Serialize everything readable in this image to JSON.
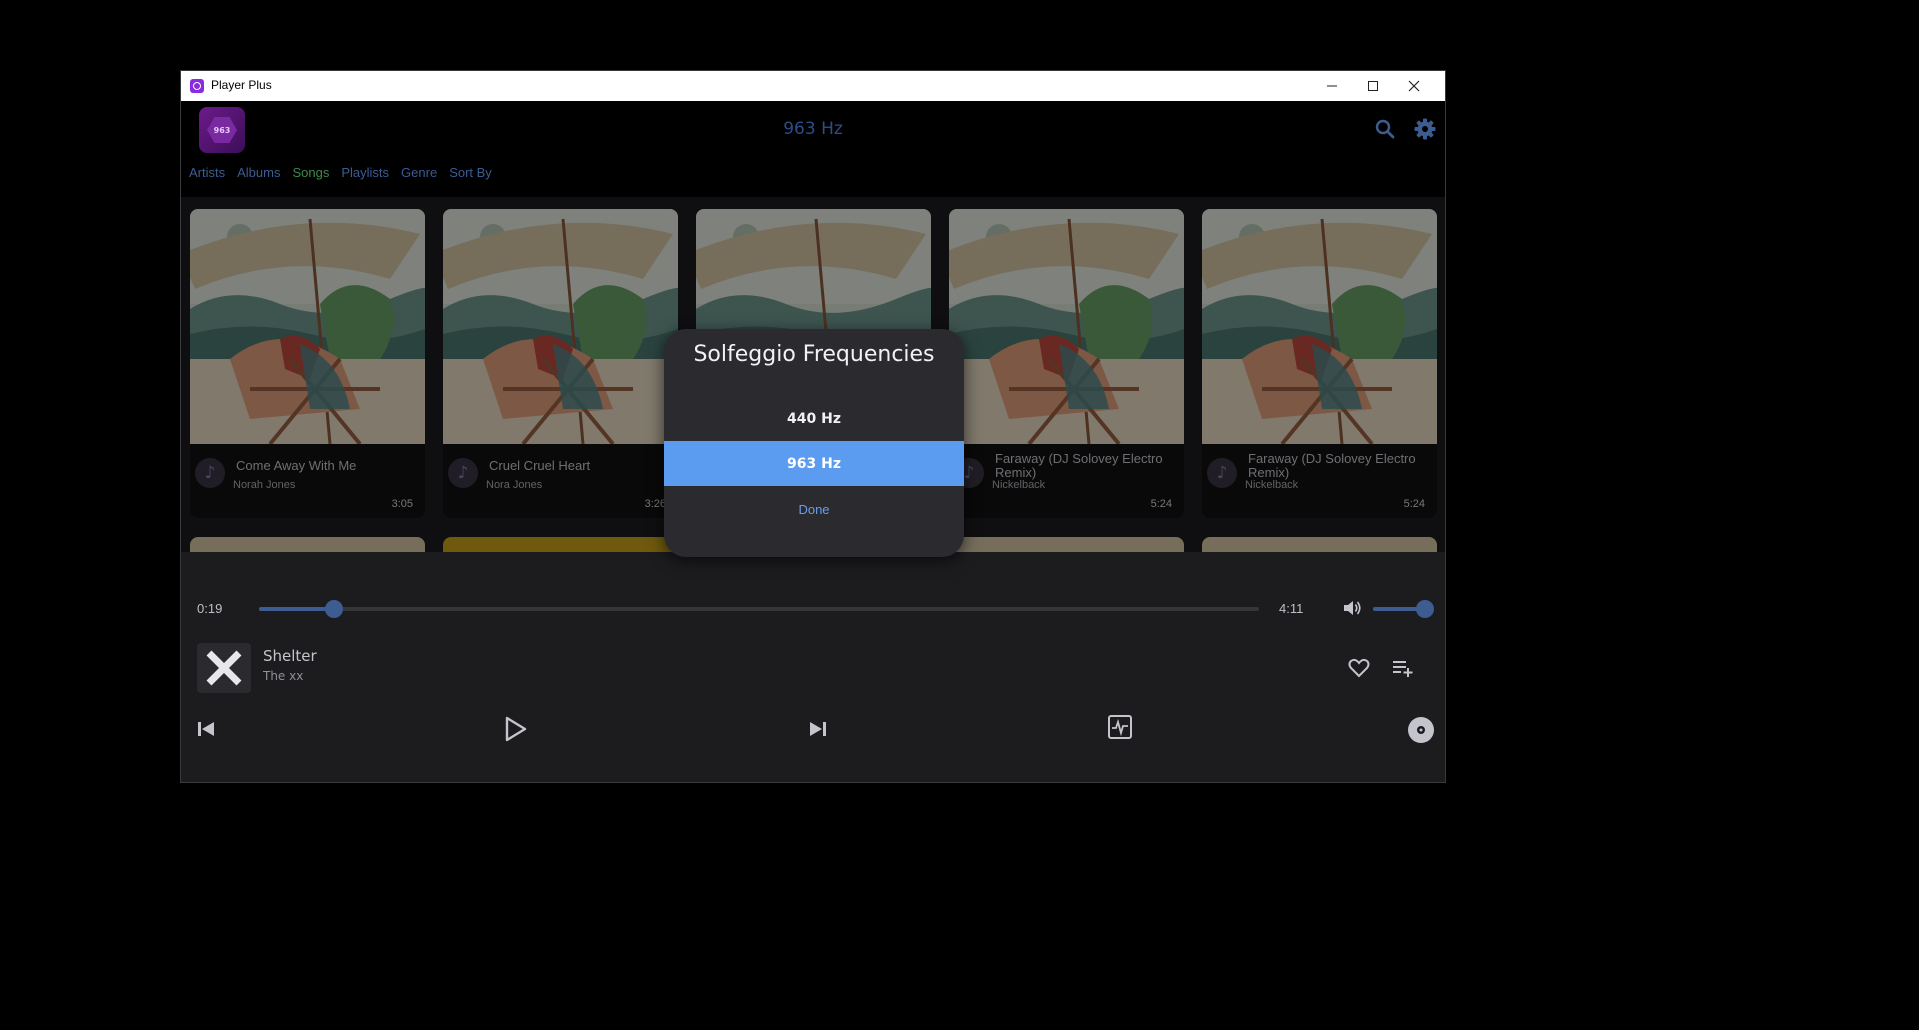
{
  "window": {
    "title": "Player Plus",
    "controls": [
      "minimize-icon",
      "maximize-icon",
      "close-icon"
    ]
  },
  "header": {
    "logo_text": "963",
    "title": "963 Hz",
    "icons": [
      "search-icon",
      "gear-icon"
    ],
    "accent_color": "#3d5c92"
  },
  "nav": {
    "items": [
      {
        "label": "Artists",
        "active": false
      },
      {
        "label": "Albums",
        "active": false
      },
      {
        "label": "Songs",
        "active": true
      },
      {
        "label": "Playlists",
        "active": false
      },
      {
        "label": "Genre",
        "active": false
      },
      {
        "label": "Sort By",
        "active": false
      }
    ]
  },
  "songs": [
    {
      "title": "Come Away With Me",
      "artist": "Norah Jones",
      "duration": "3:05"
    },
    {
      "title": "Cruel Cruel Heart",
      "artist": "Nora Jones",
      "duration": "3:26"
    },
    {
      "title": "",
      "artist": "",
      "duration": ""
    },
    {
      "title": "Faraway (DJ Solovey Electro Remix)",
      "artist": "Nickelback",
      "duration": "5:24"
    },
    {
      "title": "Faraway (DJ Solovey Electro Remix)",
      "artist": "Nickelback",
      "duration": "5:24"
    }
  ],
  "dialog": {
    "title": "Solfeggio Frequencies",
    "options": [
      {
        "label": "440 Hz",
        "selected": false
      },
      {
        "label": "963 Hz",
        "selected": true
      }
    ],
    "done_label": "Done",
    "selected_color": "#5b9bf0"
  },
  "player": {
    "elapsed": "0:19",
    "total": "4:11",
    "progress_fraction": 0.075,
    "volume_fraction": 1.0,
    "now_playing": {
      "title": "Shelter",
      "artist": "The xx"
    },
    "icons": [
      "volume-icon",
      "heart-icon",
      "add-to-playlist-icon",
      "previous-icon",
      "play-icon",
      "next-icon",
      "visualizer-icon",
      "disc-icon"
    ]
  }
}
